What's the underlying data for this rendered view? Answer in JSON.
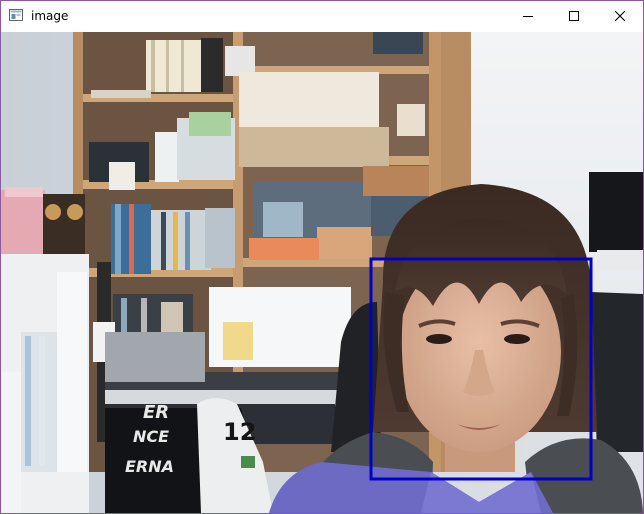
{
  "window": {
    "title": "image",
    "icons": {
      "app": "app-window-icon",
      "minimize": "minimize-icon",
      "maximize": "maximize-icon",
      "close": "close-icon"
    },
    "border_color": "#8a5a9a"
  },
  "webcam": {
    "jersey_number": "12",
    "jersey_lines": [
      "ER",
      "NCE",
      "ERNA"
    ],
    "detection_box_color": "#0000c8"
  }
}
